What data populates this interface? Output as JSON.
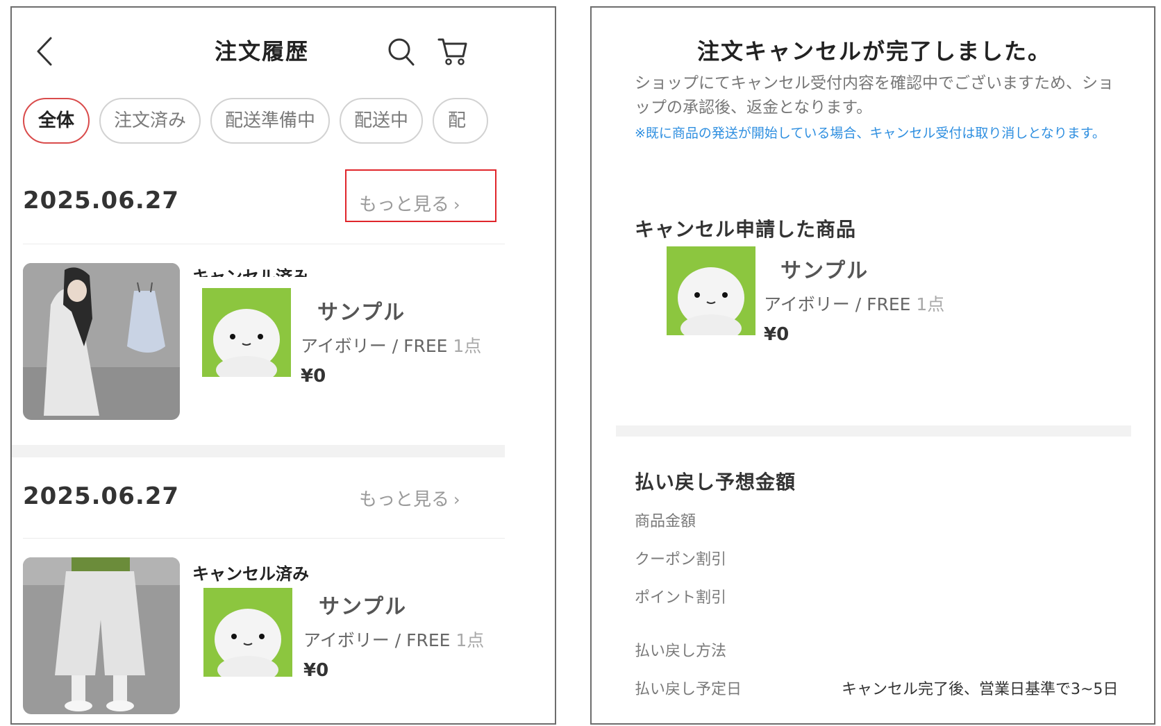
{
  "left": {
    "header": {
      "title": "注文履歴",
      "back_icon": "chevron-left-icon",
      "search_icon": "search-icon",
      "cart_icon": "cart-icon"
    },
    "tabs": [
      {
        "label": "全体",
        "active": true
      },
      {
        "label": "注文済み",
        "active": false
      },
      {
        "label": "配送準備中",
        "active": false
      },
      {
        "label": "配送中",
        "active": false
      },
      {
        "label": "配",
        "active": false
      }
    ],
    "orders": [
      {
        "date": "2025.06.27",
        "more_label": "もっと見る",
        "status": "キャンセル済み",
        "item": {
          "name": "サンプル",
          "variant": "アイボリー / FREE",
          "qty": "1点",
          "price": "¥0"
        }
      },
      {
        "date": "2025.06.27",
        "more_label": "もっと見る",
        "status": "キャンセル済み",
        "item": {
          "name": "サンプル",
          "variant": "アイボリー / FREE",
          "qty": "1点",
          "price": "¥0"
        }
      }
    ],
    "highlight_color": "#e0252b"
  },
  "right": {
    "title": "注文キャンセルが完了しました。",
    "description": "ショップにてキャンセル受付内容を確認中でございますため、ショップの承認後、返金となります。",
    "note": "※既に商品の発送が開始している場合、キャンセル受付は取り消しとなります。",
    "cancel_section": {
      "title": "キャンセル申請した商品",
      "item": {
        "name": "サンプル",
        "variant": "アイボリー / FREE",
        "qty": "1点",
        "price": "¥0"
      }
    },
    "refund_section": {
      "title": "払い戻し予想金額",
      "rows": [
        {
          "label": "商品金額",
          "value": ""
        },
        {
          "label": "クーポン割引",
          "value": ""
        },
        {
          "label": "ポイント割引",
          "value": ""
        },
        {
          "label": "払い戻し方法",
          "value": ""
        },
        {
          "label": "払い戻し予定日",
          "value": "キャンセル完了後、営業日基準で3~5日"
        }
      ]
    },
    "note_color": "#2f8fe0"
  }
}
